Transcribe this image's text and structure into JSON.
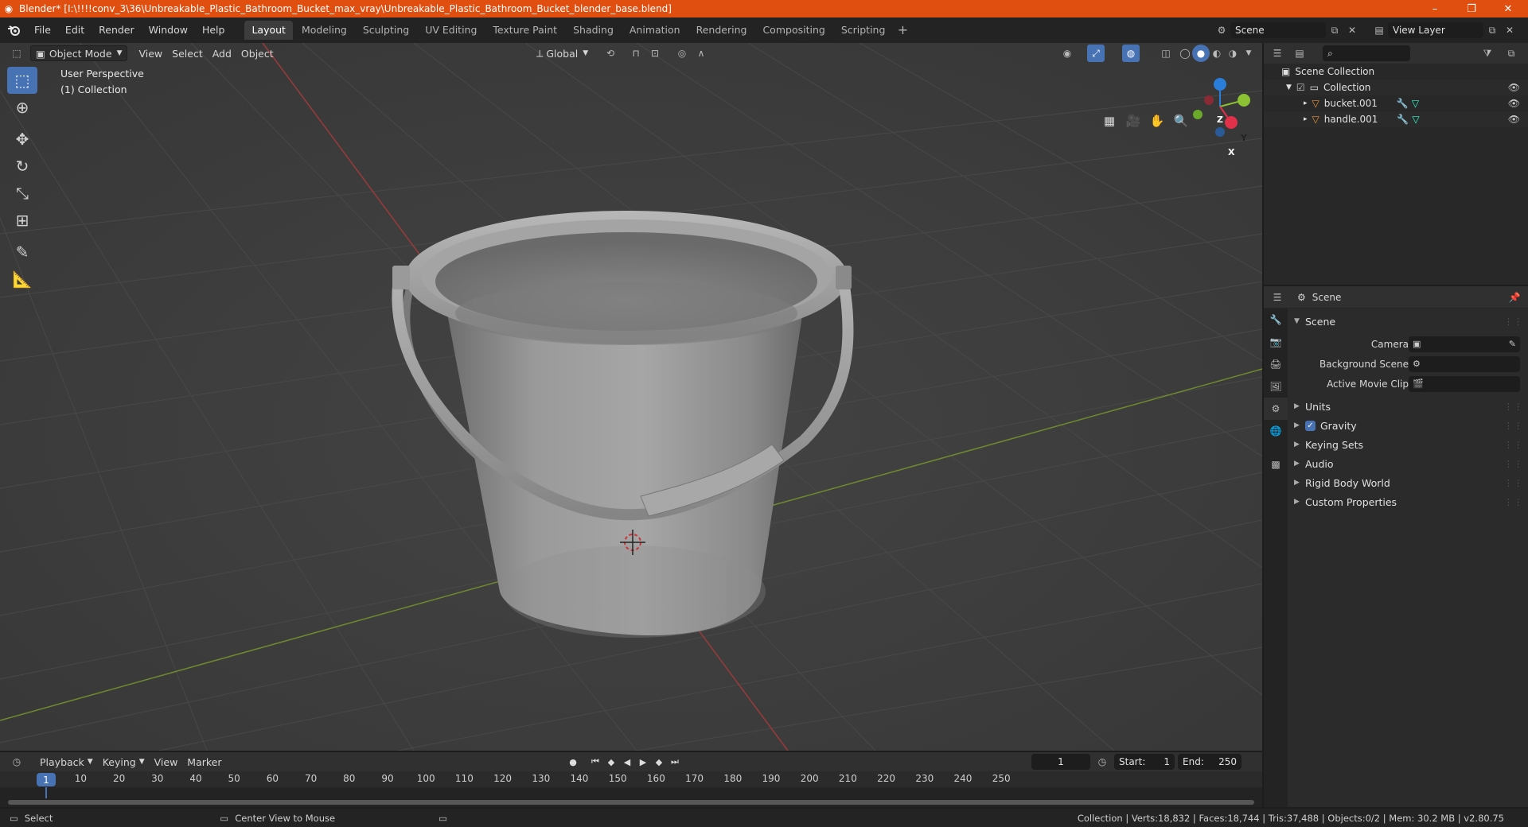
{
  "window": {
    "title": "Blender* [I:\\!!!!conv_3\\36\\Unbreakable_Plastic_Bathroom_Bucket_max_vray\\Unbreakable_Plastic_Bathroom_Bucket_blender_base.blend]",
    "controls": {
      "minimize": "–",
      "restore": "❐",
      "close": "✕"
    }
  },
  "topbar": {
    "menus": [
      "File",
      "Edit",
      "Render",
      "Window",
      "Help"
    ],
    "workspaces": [
      "Layout",
      "Modeling",
      "Sculpting",
      "UV Editing",
      "Texture Paint",
      "Shading",
      "Animation",
      "Rendering",
      "Compositing",
      "Scripting"
    ],
    "active_workspace": "Layout",
    "scene": "Scene",
    "view_layer": "View Layer"
  },
  "viewport": {
    "mode": "Object Mode",
    "menus": [
      "View",
      "Select",
      "Add",
      "Object"
    ],
    "orientation": "Global",
    "perspective_label": "User Perspective",
    "collection_label": "(1) Collection",
    "gizmo_axes": {
      "x": "X",
      "y": "Y",
      "z": "Z"
    }
  },
  "outliner": {
    "root": "Scene Collection",
    "collection": "Collection",
    "objects": [
      "bucket.001",
      "handle.001"
    ]
  },
  "properties": {
    "context": "Scene",
    "panel_title": "Scene",
    "fields": {
      "camera": "Camera",
      "background_scene": "Background Scene",
      "active_movie_clip": "Active Movie Clip"
    },
    "subpanels": {
      "units": "Units",
      "gravity": "Gravity",
      "keying_sets": "Keying Sets",
      "audio": "Audio",
      "rigid_body_world": "Rigid Body World",
      "custom_properties": "Custom Properties"
    },
    "gravity_enabled": true
  },
  "timeline": {
    "menus": [
      "Playback",
      "Keying",
      "View",
      "Marker"
    ],
    "current_frame": "1",
    "start_label": "Start:",
    "start": "1",
    "end_label": "End:",
    "end": "250",
    "ticks": [
      "10",
      "20",
      "30",
      "40",
      "50",
      "60",
      "70",
      "80",
      "90",
      "100",
      "110",
      "120",
      "130",
      "140",
      "150",
      "160",
      "170",
      "180",
      "190",
      "200",
      "210",
      "220",
      "230",
      "240",
      "250"
    ]
  },
  "statusbar": {
    "left_action": "Select",
    "middle_action": "Center View to Mouse",
    "stats": "Collection | Verts:18,832 | Faces:18,744 | Tris:37,488 | Objects:0/2 | Mem: 30.2 MB | v2.80.75"
  }
}
